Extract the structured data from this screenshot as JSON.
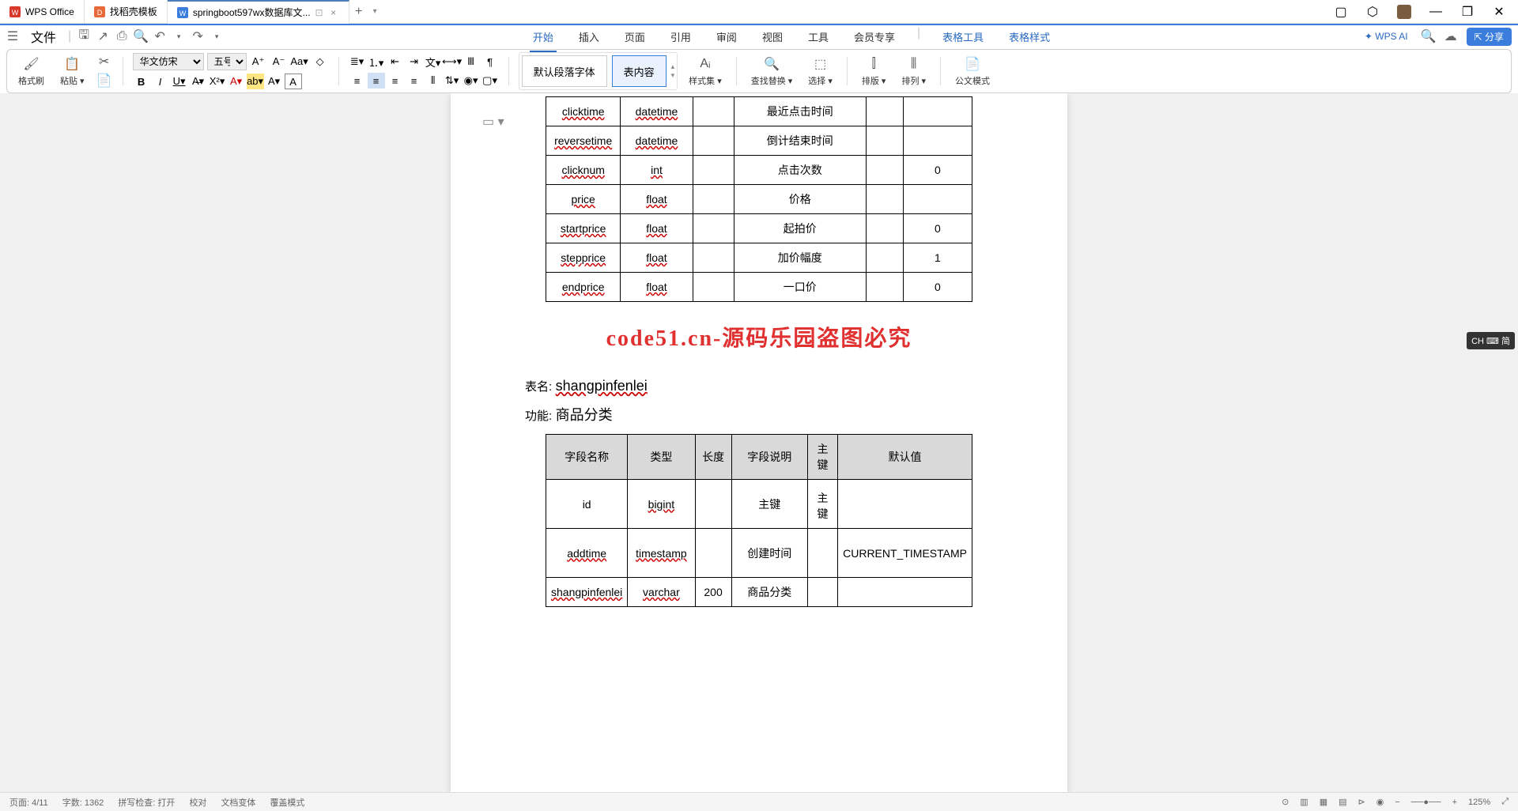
{
  "titlebar": {
    "tabs": [
      {
        "icon": "wps",
        "label": "WPS Office"
      },
      {
        "icon": "template",
        "label": "找稻壳模板"
      },
      {
        "icon": "word",
        "label": "springboot597wx数据库文..."
      }
    ],
    "add": "+"
  },
  "menubar": {
    "file": "文件",
    "tabs": [
      "开始",
      "插入",
      "页面",
      "引用",
      "审阅",
      "视图",
      "工具",
      "会员专享"
    ],
    "extra": [
      "表格工具",
      "表格样式"
    ],
    "ai": "WPS AI",
    "share": "分享"
  },
  "ribbon": {
    "format_brush": "格式刷",
    "paste": "粘贴",
    "font_name": "华文仿宋",
    "font_size": "五号",
    "style_default": "默认段落字体",
    "style_content": "表内容",
    "styles_label": "样式集",
    "find_replace": "查找替换",
    "select": "选择",
    "layout_v": "排版",
    "layout_h": "排列",
    "gov_mode": "公文模式"
  },
  "document": {
    "table1": {
      "rows": [
        {
          "c1": "clicktime",
          "c2": "datetime",
          "c3": "",
          "c4": "最近点击时间",
          "c5": "",
          "c6": ""
        },
        {
          "c1": "reversetime",
          "c2": "datetime",
          "c3": "",
          "c4": "倒计结束时间",
          "c5": "",
          "c6": ""
        },
        {
          "c1": "clicknum",
          "c2": "int",
          "c3": "",
          "c4": "点击次数",
          "c5": "",
          "c6": "0"
        },
        {
          "c1": "price",
          "c2": "float",
          "c3": "",
          "c4": "价格",
          "c5": "",
          "c6": ""
        },
        {
          "c1": "startprice",
          "c2": "float",
          "c3": "",
          "c4": "起拍价",
          "c5": "",
          "c6": "0"
        },
        {
          "c1": "stepprice",
          "c2": "float",
          "c3": "",
          "c4": "加价幅度",
          "c5": "",
          "c6": "1"
        },
        {
          "c1": "endprice",
          "c2": "float",
          "c3": "",
          "c4": "一口价",
          "c5": "",
          "c6": "0"
        }
      ]
    },
    "watermark": "code51.cn-源码乐园盗图必究",
    "table2_name_label": "表名:",
    "table2_name": "shangpinfenlei",
    "table2_func_label": "功能:",
    "table2_func": "商品分类",
    "table2": {
      "headers": [
        "字段名称",
        "类型",
        "长度",
        "字段说明",
        "主键",
        "默认值"
      ],
      "rows": [
        {
          "c1": "id",
          "c2": "bigint",
          "c3": "",
          "c4": "主键",
          "c5": "主键",
          "c6": ""
        },
        {
          "c1": "addtime",
          "c2": "timestamp",
          "c3": "",
          "c4": "创建时间",
          "c5": "",
          "c6": "CURRENT_TIMESTAMP"
        },
        {
          "c1": "shangpinfenlei",
          "c2": "varchar",
          "c3": "200",
          "c4": "商品分类",
          "c5": "",
          "c6": ""
        }
      ]
    }
  },
  "statusbar": {
    "page": "页面: 4/11",
    "words": "字数: 1362",
    "spell": "拼写检查: 打开",
    "proof": "校对",
    "comments": "文档变体",
    "mode": "覆盖模式",
    "zoom": "125%"
  },
  "ime": "CH ⌨ 简"
}
